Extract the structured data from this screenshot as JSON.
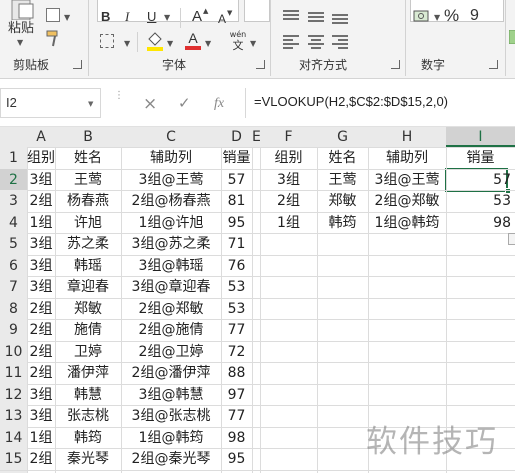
{
  "ribbon": {
    "clipboard": {
      "paste_label": "粘贴",
      "group_label": "剪贴板"
    },
    "font": {
      "group_label": "字体",
      "bold": "B",
      "italic": "I",
      "underline": "U",
      "grow": "A",
      "shrink": "A",
      "fill_color": "#ffe600",
      "font_color": "#e03030",
      "wen_top": "wén",
      "wen_char": "文"
    },
    "alignment": {
      "group_label": "对齐方式"
    },
    "number": {
      "group_label": "数字",
      "percent": "%",
      "comma": "9"
    }
  },
  "formula_bar": {
    "name_box": "I2",
    "cancel_icon": "×",
    "enter_icon": "✓",
    "fx_label": "fx",
    "formula": "=VLOOKUP(H2,$C$2:$D$15,2,0)"
  },
  "columns": [
    "A",
    "B",
    "C",
    "D",
    "E",
    "F",
    "G",
    "H",
    "I"
  ],
  "row_numbers": [
    "1",
    "2",
    "3",
    "4",
    "5",
    "6",
    "7",
    "8",
    "9",
    "10",
    "11",
    "12",
    "13",
    "14",
    "15"
  ],
  "left_table": {
    "headers": [
      "组别",
      "姓名",
      "辅助列",
      "销量"
    ],
    "rows": [
      [
        "3组",
        "王莺",
        "3组@王莺",
        "57"
      ],
      [
        "2组",
        "杨春燕",
        "2组@杨春燕",
        "81"
      ],
      [
        "1组",
        "许旭",
        "1组@许旭",
        "95"
      ],
      [
        "3组",
        "苏之柔",
        "3组@苏之柔",
        "71"
      ],
      [
        "3组",
        "韩瑶",
        "3组@韩瑶",
        "76"
      ],
      [
        "3组",
        "章迎春",
        "3组@章迎春",
        "53"
      ],
      [
        "2组",
        "郑敏",
        "2组@郑敏",
        "53"
      ],
      [
        "2组",
        "施倩",
        "2组@施倩",
        "77"
      ],
      [
        "2组",
        "卫婷",
        "2组@卫婷",
        "72"
      ],
      [
        "2组",
        "潘伊萍",
        "2组@潘伊萍",
        "88"
      ],
      [
        "3组",
        "韩慧",
        "3组@韩慧",
        "97"
      ],
      [
        "3组",
        "张志桃",
        "3组@张志桃",
        "77"
      ],
      [
        "1组",
        "韩筠",
        "1组@韩筠",
        "98"
      ],
      [
        "2组",
        "秦光琴",
        "2组@秦光琴",
        "95"
      ]
    ]
  },
  "right_table": {
    "headers": [
      "组别",
      "姓名",
      "辅助列",
      "销量"
    ],
    "rows": [
      [
        "3组",
        "王莺",
        "3组@王莺",
        "57"
      ],
      [
        "2组",
        "郑敏",
        "2组@郑敏",
        "53"
      ],
      [
        "1组",
        "韩筠",
        "1组@韩筠",
        "98"
      ]
    ]
  },
  "selected_cell": "I2",
  "watermark": "软件技巧",
  "colors": {
    "accent_green": "#1f7145",
    "header_bg": "#eaeaea",
    "grid": "#dcdcdc"
  }
}
